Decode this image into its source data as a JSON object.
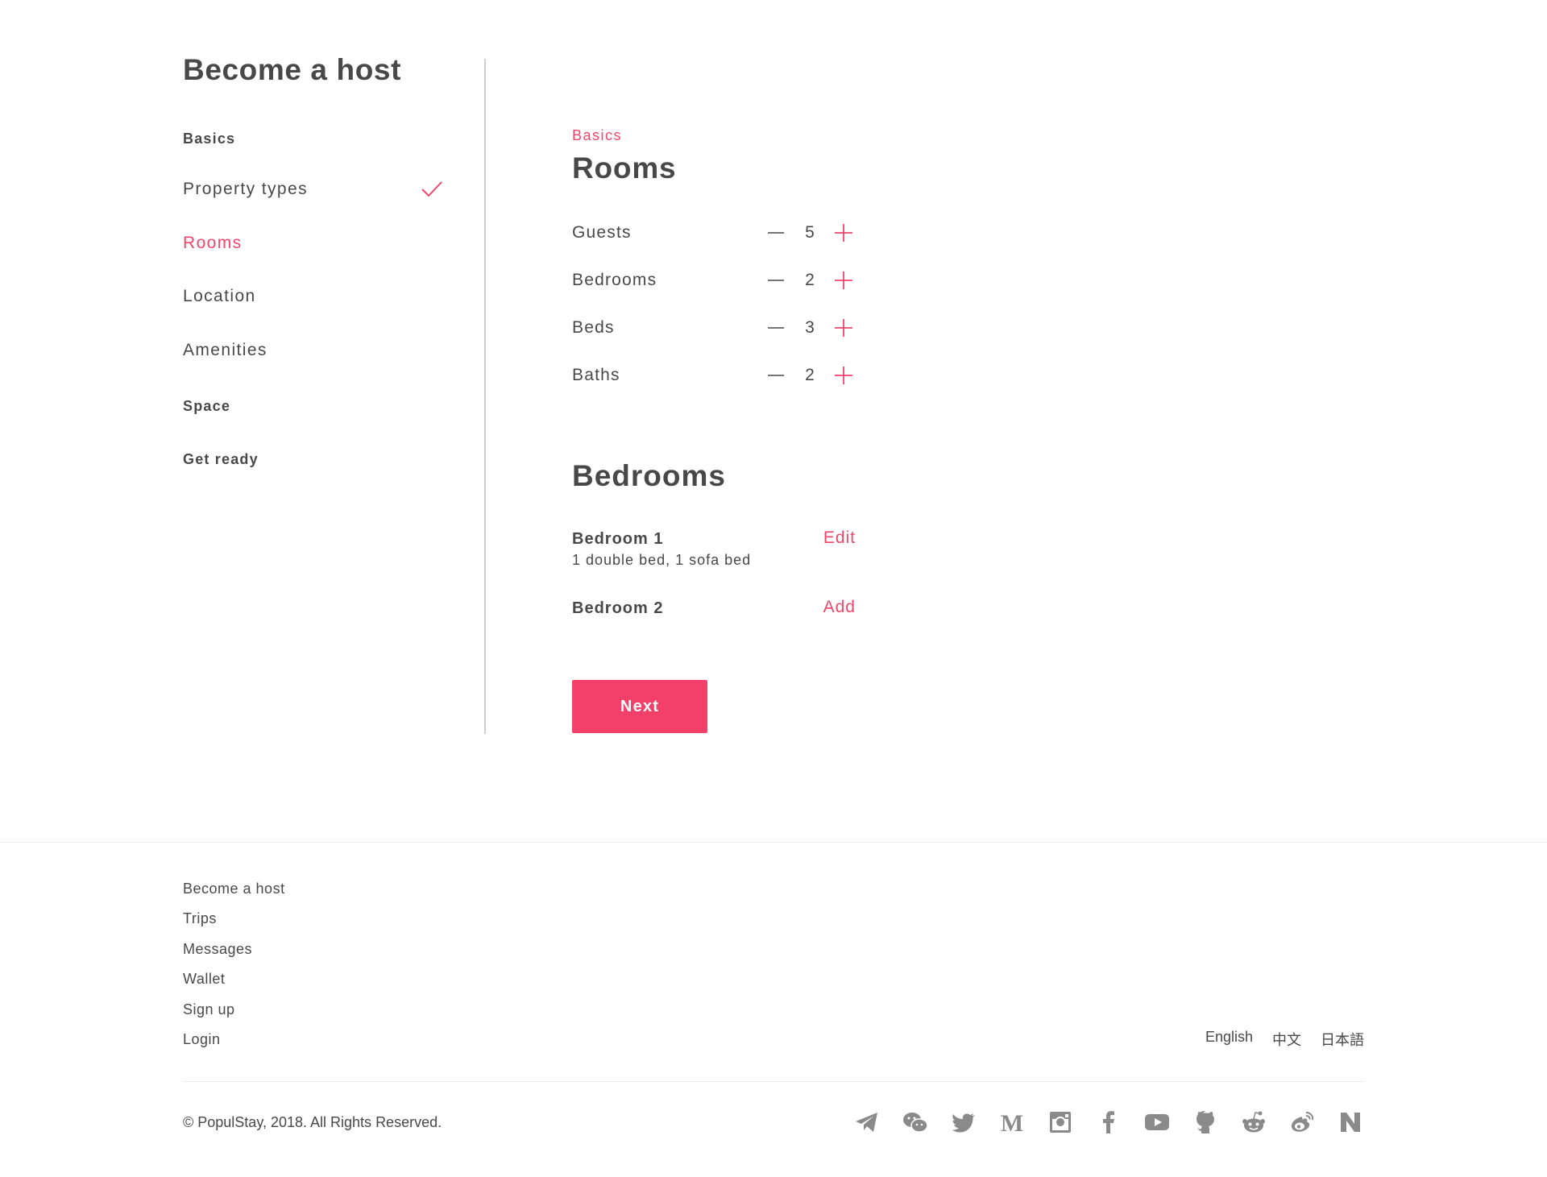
{
  "sidebar": {
    "title": "Become a host",
    "items": [
      {
        "label": "Basics",
        "type": "section"
      },
      {
        "label": "Property types",
        "type": "sub",
        "completed": true
      },
      {
        "label": "Rooms",
        "type": "sub",
        "active": true
      },
      {
        "label": "Location",
        "type": "sub"
      },
      {
        "label": "Amenities",
        "type": "sub"
      },
      {
        "label": "Space",
        "type": "section"
      },
      {
        "label": "Get ready",
        "type": "section"
      }
    ]
  },
  "main": {
    "eyebrow": "Basics",
    "title": "Rooms",
    "counters": [
      {
        "label": "Guests",
        "value": "5"
      },
      {
        "label": "Bedrooms",
        "value": "2"
      },
      {
        "label": "Beds",
        "value": "3"
      },
      {
        "label": "Baths",
        "value": "2"
      }
    ],
    "bedrooms_title": "Bedrooms",
    "bedrooms": [
      {
        "name": "Bedroom 1",
        "description": "1 double bed, 1 sofa bed",
        "action": "Edit"
      },
      {
        "name": "Bedroom 2",
        "description": "",
        "action": "Add"
      }
    ],
    "next_label": "Next"
  },
  "footer": {
    "links": [
      "Become a host",
      "Trips",
      "Messages",
      "Wallet",
      "Sign up",
      "Login"
    ],
    "languages": [
      "English",
      "中文",
      "日本語"
    ],
    "copyright": "© PopulStay, 2018. All Rights Reserved.",
    "social_icons": [
      "telegram-icon",
      "wechat-icon",
      "twitter-icon",
      "medium-icon",
      "instagram-icon",
      "facebook-icon",
      "youtube-icon",
      "github-icon",
      "reddit-icon",
      "weibo-icon",
      "n-icon"
    ]
  },
  "colors": {
    "accent": "#f0466b",
    "text": "#484848",
    "icon_gray": "#8a8a8a",
    "divider": "#cfcfcf"
  }
}
